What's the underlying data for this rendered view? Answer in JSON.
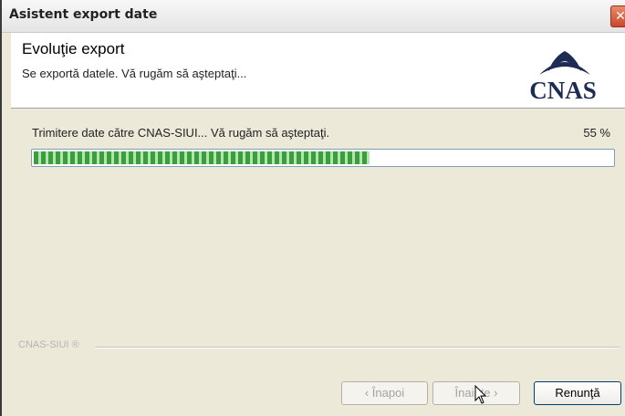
{
  "window": {
    "title": "Asistent export date",
    "close_symbol": "✕"
  },
  "header": {
    "title": "Evoluţie export",
    "subtitle": "Se exportă datele. Vă rugăm să aşteptaţi...",
    "logo_text": "CNAS"
  },
  "progress": {
    "status": "Trimitere date către CNAS-SIUI... Vă rugăm să aşteptaţi.",
    "percent_label": "55 %",
    "value": 0.58
  },
  "footer": {
    "brand": "CNAS-SIUI ®",
    "back_label": "‹ Înapoi",
    "next_label": "Înainte ›",
    "cancel_label": "Renunţă"
  },
  "colors": {
    "progress": "#3a9f3a",
    "logo": "#1d2b55",
    "close": "#c9482a"
  },
  "icons": {
    "close": "close-icon",
    "logo": "cnas-logo-icon",
    "cursor": "mouse-cursor-icon"
  }
}
